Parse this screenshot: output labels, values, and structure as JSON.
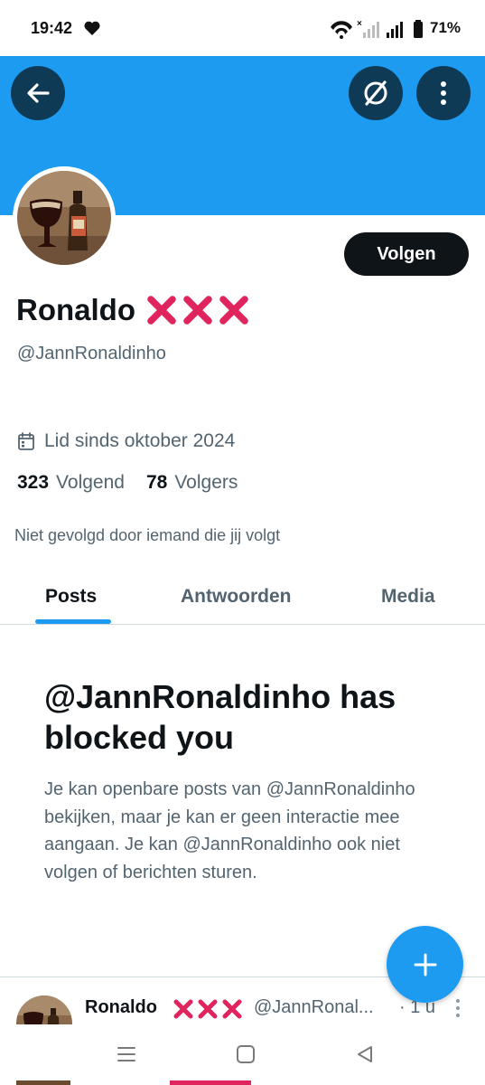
{
  "status_bar": {
    "time": "19:42",
    "battery_percent": "71%",
    "icons": [
      "heart-icon",
      "wifi-icon",
      "signal-muted-icon",
      "signal-icon",
      "battery-icon"
    ]
  },
  "header": {
    "banner_color": "#1d9bf0",
    "back_icon": "arrow-left-icon",
    "grok_icon": "grok-icon",
    "more_icon": "more-vertical-icon"
  },
  "profile": {
    "display_name": "Ronaldo",
    "name_emoji": "❌❌❌",
    "handle": "@JannRonaldinho",
    "follow_label": "Volgen",
    "joined": "Lid sinds oktober 2024",
    "following_count": "323",
    "following_label": "Volgend",
    "followers_count": "78",
    "followers_label": "Volgers",
    "not_followed_text": "Niet gevolgd door iemand die jij volgt"
  },
  "tabs": [
    {
      "label": "Posts",
      "active": true
    },
    {
      "label": "Antwoorden",
      "active": false
    },
    {
      "label": "Media",
      "active": false
    }
  ],
  "blocked": {
    "title": "@JannRonaldinho has blocked you",
    "description": "Je kan openbare posts van @JannRonaldinho bekijken, maar je kan er geen interactie mee aangaan. Je kan @JannRonaldinho ook niet volgen of berichten sturen."
  },
  "post_preview": {
    "name": "Ronaldo",
    "name_emoji": "❌❌❌",
    "handle": "@JannRonal...",
    "time": "· 1 u"
  },
  "colors": {
    "accent": "#1d9bf0",
    "dark_button": "#0f1419",
    "icon_circle": "#0f3a56",
    "secondary_text": "#536471",
    "red_x": "#e0245e"
  }
}
